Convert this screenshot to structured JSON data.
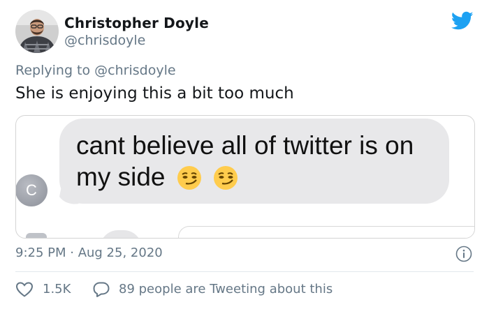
{
  "author": {
    "name": "Christopher Doyle",
    "handle": "@chrisdoyle",
    "avatar": "avatar-photo"
  },
  "header": {
    "logo_icon": "twitter-bird-icon",
    "logo_color": "#1da1f2"
  },
  "tweet": {
    "replying_prefix": "Replying to",
    "replying_handle": "@chrisdoyle",
    "text": "She is enjoying this a bit too much"
  },
  "media": {
    "message_text": "cant believe all of twitter is on my side",
    "message_emojis": [
      "smirking-face-emoji",
      "smirking-face-emoji"
    ],
    "contact_initial": "C",
    "bubble_color": "#e8e8ea"
  },
  "meta": {
    "timestamp": "9:25 PM · Aug 25, 2020",
    "info_icon": "info-icon"
  },
  "actions": {
    "like_count": "1.5K",
    "like_icon": "heart-icon",
    "tweeting_icon": "chat-bubble-icon",
    "tweeting_text": "89 people are Tweeting about this",
    "muted_color": "#657786"
  }
}
